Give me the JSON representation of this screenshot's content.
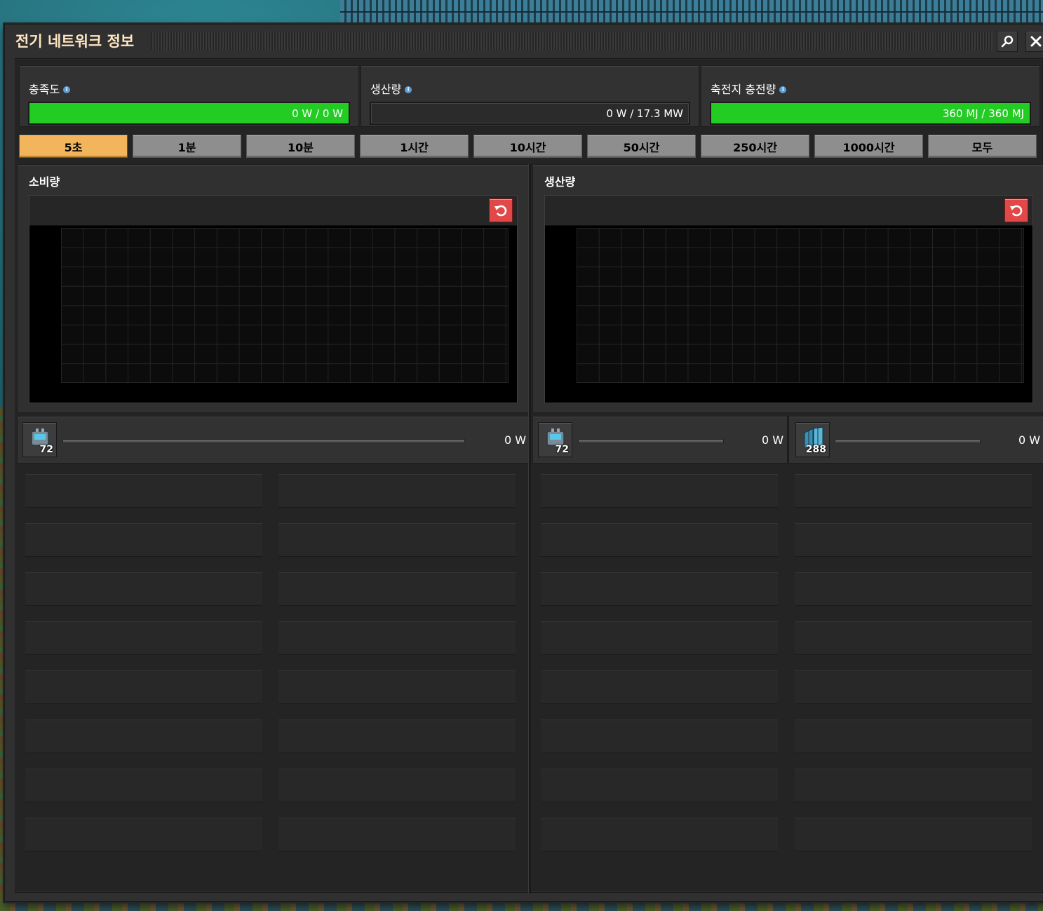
{
  "window": {
    "title": "전기 네트워크 정보"
  },
  "stats": {
    "satisfaction": {
      "label": "충족도",
      "value": "0 W / 0 W",
      "fill": 1.0,
      "color": "#22cc22"
    },
    "production": {
      "label": "생산량",
      "value": "0 W / 17.3 MW",
      "fill": 0.0
    },
    "accumulator": {
      "label": "축전지 충전량",
      "value": "360 MJ / 360 MJ",
      "fill": 1.0,
      "color": "#22cc22"
    }
  },
  "tabs": [
    {
      "label": "5초",
      "active": true
    },
    {
      "label": "1분"
    },
    {
      "label": "10분"
    },
    {
      "label": "1시간"
    },
    {
      "label": "10시간"
    },
    {
      "label": "50시간"
    },
    {
      "label": "250시간"
    },
    {
      "label": "1000시간"
    },
    {
      "label": "모두"
    }
  ],
  "panels": {
    "consumption": {
      "title": "소비량"
    },
    "production": {
      "title": "생산량"
    }
  },
  "entities": {
    "consumption": [
      {
        "icon": "accumulator-icon",
        "count": "72",
        "value": "0 W"
      }
    ],
    "production": [
      {
        "icon": "accumulator-icon",
        "count": "72",
        "value": "0 W"
      },
      {
        "icon": "solar-panel-icon",
        "count": "288",
        "value": "0 W"
      }
    ]
  },
  "colors": {
    "accent_tab": "#f2b55c",
    "bar_green": "#22cc22",
    "reset_red": "#e34848",
    "title_text": "#ffe6c0"
  }
}
